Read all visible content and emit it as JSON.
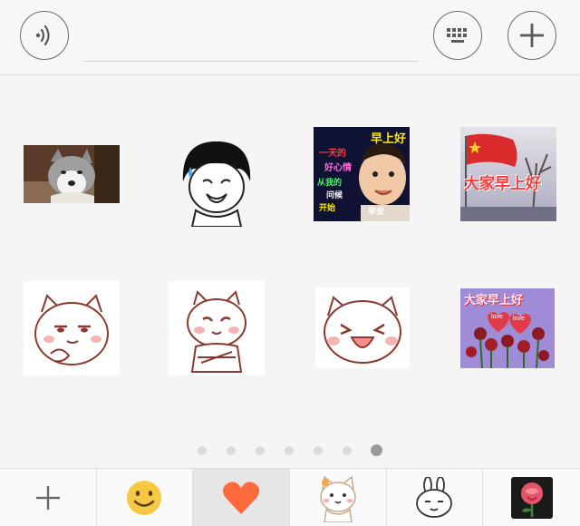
{
  "toolbar": {
    "voice_icon": "voice-wave-icon",
    "keyboard_icon": "keyboard-icon",
    "plus_icon": "plus-icon"
  },
  "stickers_row1": [
    {
      "name": "husky-dog-sticker"
    },
    {
      "name": "crying-bowlcut-boy-sticker"
    },
    {
      "name": "good-morning-baby-sticker",
      "lines": [
        "早上好",
        "一天的",
        "好心情",
        "从我的",
        "问候",
        "开始"
      ],
      "badge": "早安"
    },
    {
      "name": "good-morning-flag-sticker",
      "text": "大家早上好"
    }
  ],
  "stickers_row2": [
    {
      "name": "cat-smirk-hand-chin-sticker"
    },
    {
      "name": "cat-arms-crossed-sticker"
    },
    {
      "name": "cat-laughing-sticker"
    },
    {
      "name": "good-morning-roses-sticker",
      "text": "大家早上好",
      "hearts": [
        "love",
        "love"
      ]
    }
  ],
  "pagination": {
    "count": 7,
    "active_index": 6
  },
  "tabs": [
    {
      "name": "add-sticker-tab",
      "icon": "plus-icon"
    },
    {
      "name": "emoji-tab",
      "icon": "smiley-icon"
    },
    {
      "name": "favorites-tab",
      "icon": "heart-icon",
      "selected": true
    },
    {
      "name": "cat-pack-tab",
      "icon": "cat-icon"
    },
    {
      "name": "rabbit-pack-tab",
      "icon": "rabbit-icon"
    },
    {
      "name": "rose-pack-tab",
      "icon": "rose-icon"
    }
  ],
  "colors": {
    "heart": "#ff6a3d",
    "smiley": "#f7c843",
    "accent_red": "#d92b2b"
  }
}
